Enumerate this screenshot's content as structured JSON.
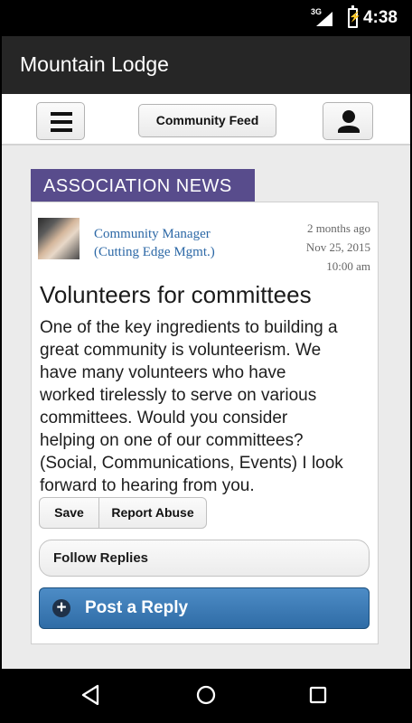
{
  "status_bar": {
    "network": "3G",
    "time": "4:38"
  },
  "app": {
    "title": "Mountain Lodge"
  },
  "top_bar": {
    "community_feed_label": "Community Feed"
  },
  "post": {
    "category": "ASSOCIATION NEWS",
    "author_line1": "Community Manager",
    "author_line2": "(Cutting Edge Mgmt.)",
    "relative_time": "2 months ago",
    "date": "Nov 25, 2015",
    "time": "10:00 am",
    "title": "Volunteers for committees",
    "body_lines": [
      "One of the key ingredients to building a",
      "great community is volunteerism. We",
      "have many volunteers who have",
      "worked tirelessly to serve on various",
      "committees. Would you consider",
      "helping on one of our committees?",
      "(Social, Communications, Events) I look",
      "forward to hearing from you."
    ]
  },
  "actions": {
    "save": "Save",
    "report_abuse": "Report Abuse",
    "follow_replies": "Follow Replies",
    "post_reply": "Post a Reply"
  },
  "icons": {
    "menu": "menu-icon",
    "user": "user-icon",
    "plus": "plus-circle-icon",
    "back": "back-triangle-icon",
    "home": "home-circle-icon",
    "recents": "recents-square-icon",
    "signal": "cellular-signal-icon",
    "battery": "battery-charging-icon"
  },
  "colors": {
    "app_bar": "#262626",
    "category_tab": "#584c8c",
    "link_blue": "#2c68a6",
    "reply_button": "#3f7dba"
  }
}
